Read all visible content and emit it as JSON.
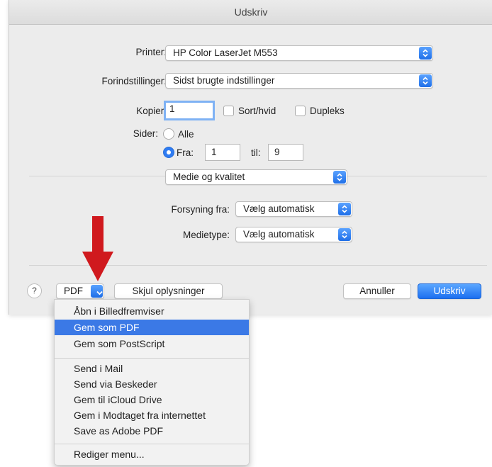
{
  "window": {
    "title": "Udskriv"
  },
  "printer": {
    "label": "Printer:",
    "value": "HP Color LaserJet M553"
  },
  "presets": {
    "label": "Forindstillinger:",
    "value": "Sidst brugte indstillinger"
  },
  "copies": {
    "label": "Kopier:",
    "value": "1",
    "bw_label": "Sort/hvid",
    "duplex_label": "Dupleks"
  },
  "pages": {
    "label": "Sider:",
    "all_label": "Alle",
    "from_label": "Fra:",
    "from_value": "1",
    "to_label": "til:",
    "to_value": "9"
  },
  "section": {
    "value": "Medie og kvalitet"
  },
  "feed": {
    "label": "Forsyning fra:",
    "value": "Vælg automatisk"
  },
  "media_type": {
    "label": "Medietype:",
    "value": "Vælg automatisk"
  },
  "footer": {
    "help": "?",
    "pdf": "PDF",
    "hide_details": "Skjul oplysninger",
    "cancel": "Annuller",
    "print": "Udskriv"
  },
  "pdf_menu": {
    "items": [
      "Åbn i Billedfremviser",
      "Gem som PDF",
      "Gem som PostScript",
      "Send i Mail",
      "Send via Beskeder",
      "Gem til iCloud Drive",
      "Gem i Modtaget fra internettet",
      "Save as Adobe PDF",
      "Rediger menu..."
    ],
    "selected_index": 1
  },
  "colors": {
    "accent": "#2f7cf2",
    "annotation_arrow": "#d0191e",
    "menu_highlight": "#3b79e6"
  }
}
